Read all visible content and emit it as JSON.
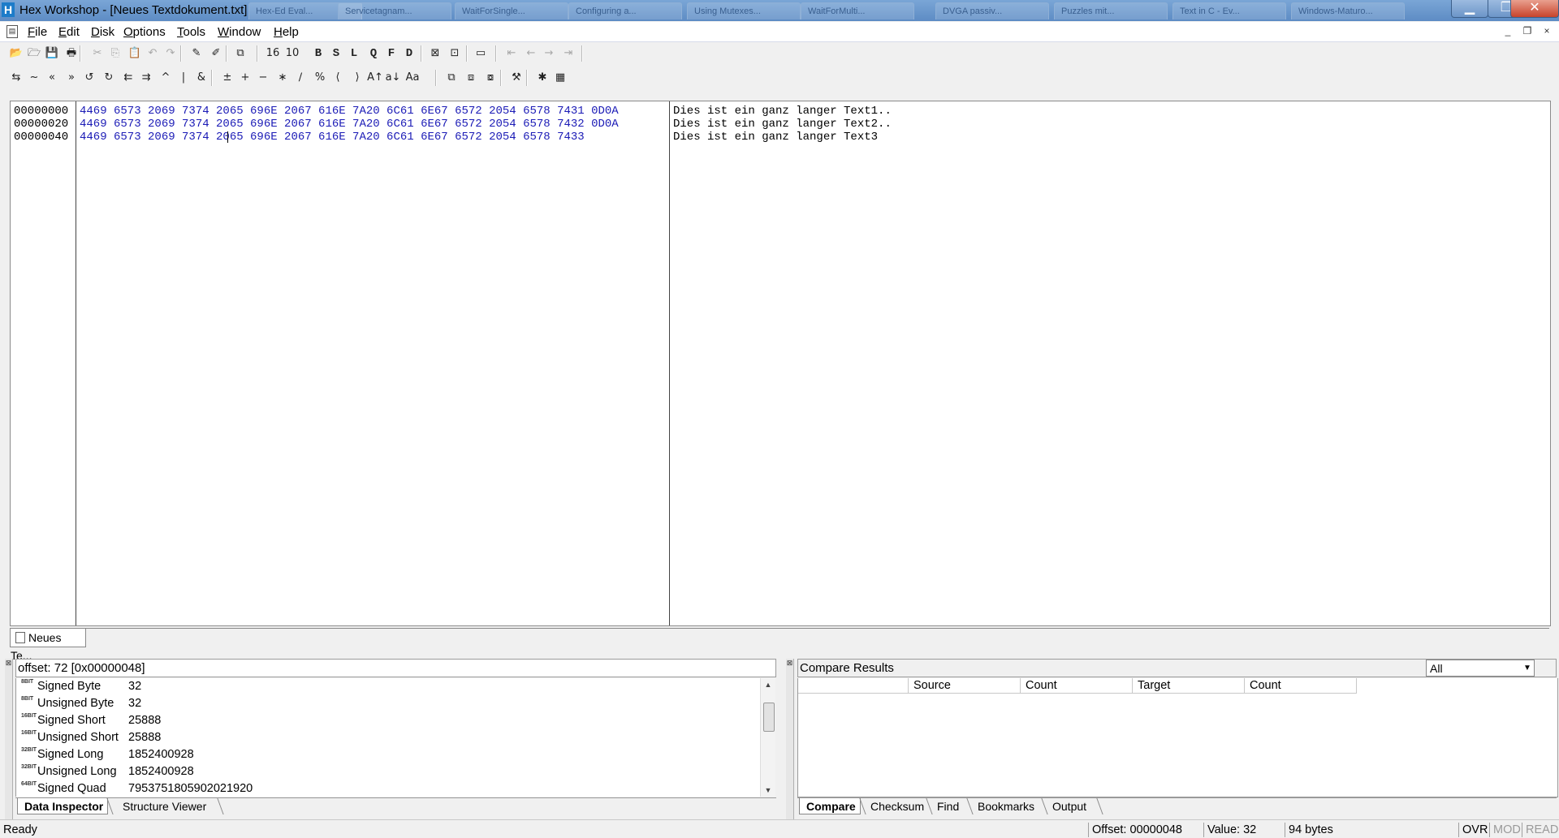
{
  "window": {
    "title": "Hex Workshop - [Neues Textdokument.txt]",
    "app_icon_letter": "H",
    "background_tabs": [
      "Hex-Ed Eval...",
      "Servicetagnam...",
      "WaitForSingle...",
      "Configuring a...",
      "Using Mutexes...",
      "WaitForMulti...",
      "DVGA passiv...",
      "Puzzles mit...",
      "Text in C - Ev...",
      "Windows-Maturo..."
    ],
    "caption_buttons": {
      "minimize": "▁",
      "maximize": "❐",
      "close": "✕"
    }
  },
  "menu": {
    "items": [
      {
        "label": "File",
        "accel": "F"
      },
      {
        "label": "Edit",
        "accel": "E"
      },
      {
        "label": "Disk",
        "accel": "D"
      },
      {
        "label": "Options",
        "accel": "O"
      },
      {
        "label": "Tools",
        "accel": "T"
      },
      {
        "label": "Window",
        "accel": "W"
      },
      {
        "label": "Help",
        "accel": "H"
      }
    ],
    "mdi_buttons": {
      "minimize": "_",
      "restore": "❐",
      "close": "×"
    }
  },
  "toolbar1": {
    "buttons": [
      {
        "name": "open-icon",
        "glyph": "📂"
      },
      {
        "name": "open-folder-icon",
        "glyph": "🗁"
      },
      {
        "name": "save-icon",
        "glyph": "💾"
      },
      {
        "name": "print-icon",
        "glyph": "🖶"
      },
      {
        "name": "cut-icon",
        "glyph": "✂"
      },
      {
        "name": "copy-icon",
        "glyph": "⎘"
      },
      {
        "name": "paste-icon",
        "glyph": "📋"
      },
      {
        "name": "undo-icon",
        "glyph": "↶"
      },
      {
        "name": "redo-icon",
        "glyph": "↷"
      },
      {
        "name": "find-icon",
        "glyph": "✎"
      },
      {
        "name": "replace-icon",
        "glyph": "✐"
      },
      {
        "name": "goto-icon",
        "glyph": "⧉"
      },
      {
        "name": "base-hex-icon",
        "glyph": "16"
      },
      {
        "name": "base-dec-icon",
        "glyph": "10"
      },
      {
        "name": "byte-icon",
        "glyph": "B"
      },
      {
        "name": "short-icon",
        "glyph": "S"
      },
      {
        "name": "long-icon",
        "glyph": "L"
      },
      {
        "name": "quad-icon",
        "glyph": "Q"
      },
      {
        "name": "float-icon",
        "glyph": "F"
      },
      {
        "name": "double-icon",
        "glyph": "D"
      },
      {
        "name": "edit-mode-icon",
        "glyph": "⊠"
      },
      {
        "name": "insert-mode-icon",
        "glyph": "⊡"
      },
      {
        "name": "window-icon",
        "glyph": "▭"
      },
      {
        "name": "first-icon",
        "glyph": "⇤"
      },
      {
        "name": "prev-icon",
        "glyph": "←"
      },
      {
        "name": "next-icon",
        "glyph": "→"
      },
      {
        "name": "last-icon",
        "glyph": "⇥"
      }
    ]
  },
  "toolbar2": {
    "buttons": [
      {
        "name": "swap-icon",
        "glyph": "⇆"
      },
      {
        "name": "not-icon",
        "glyph": "~"
      },
      {
        "name": "shift-left-icon",
        "glyph": "«"
      },
      {
        "name": "shift-right-icon",
        "glyph": "»"
      },
      {
        "name": "rotate-left-icon",
        "glyph": "↺"
      },
      {
        "name": "rotate-right-icon",
        "glyph": "↻"
      },
      {
        "name": "block-shift-left-icon",
        "glyph": "⇇"
      },
      {
        "name": "block-shift-right-icon",
        "glyph": "⇉"
      },
      {
        "name": "xor-icon",
        "glyph": "^"
      },
      {
        "name": "or-icon",
        "glyph": "|"
      },
      {
        "name": "and-icon",
        "glyph": "&"
      },
      {
        "name": "negate-icon",
        "glyph": "±"
      },
      {
        "name": "add-icon",
        "glyph": "+"
      },
      {
        "name": "subtract-icon",
        "glyph": "−"
      },
      {
        "name": "multiply-icon",
        "glyph": "∗"
      },
      {
        "name": "divide-icon",
        "glyph": "∕"
      },
      {
        "name": "modulo-icon",
        "glyph": "%"
      },
      {
        "name": "lower-bound-icon",
        "glyph": "⟨"
      },
      {
        "name": "upper-bound-icon",
        "glyph": "⟩"
      },
      {
        "name": "uppercase-icon",
        "glyph": "A↑"
      },
      {
        "name": "lowercase-icon",
        "glyph": "a↓"
      },
      {
        "name": "invert-case-icon",
        "glyph": "Aa"
      },
      {
        "name": "compare-icon",
        "glyph": "⧉"
      },
      {
        "name": "compare-next-icon",
        "glyph": "⧈"
      },
      {
        "name": "compare-prev-icon",
        "glyph": "⧇"
      },
      {
        "name": "tools-icon",
        "glyph": "⚒"
      },
      {
        "name": "chip-icon",
        "glyph": "✱"
      },
      {
        "name": "calculator-icon",
        "glyph": "▦"
      }
    ]
  },
  "editor": {
    "offsets": [
      "00000000",
      "00000020",
      "00000040"
    ],
    "hex_lines": [
      "4469 6573 2069 7374 2065 696E 2067 616E 7A20 6C61 6E67 6572 2054 6578 7431 0D0A",
      "4469 6573 2069 7374 2065 696E 2067 616E 7A20 6C61 6E67 6572 2054 6578 7432 0D0A",
      "4469 6573 2069 7374 2065 696E 2067 616E 7A20 6C61 6E67 6572 2054 6578 7433"
    ],
    "ascii_lines": [
      "Dies ist ein ganz langer Text1..",
      "Dies ist ein ganz langer Text2..",
      "Dies ist ein ganz langer Text3"
    ],
    "doc_tab": "Neues Te..."
  },
  "inspector": {
    "header": "offset: 72 [0x00000048]",
    "rows": [
      {
        "badge": "8BIT",
        "name": "Signed Byte",
        "value": "32"
      },
      {
        "badge": "8BIT",
        "name": "Unsigned Byte",
        "value": "32"
      },
      {
        "badge": "16BIT",
        "name": "Signed Short",
        "value": "25888"
      },
      {
        "badge": "16BIT",
        "name": "Unsigned Short",
        "value": "25888"
      },
      {
        "badge": "32BIT",
        "name": "Signed Long",
        "value": "1852400928"
      },
      {
        "badge": "32BIT",
        "name": "Unsigned Long",
        "value": "1852400928"
      },
      {
        "badge": "64BIT",
        "name": "Signed Quad",
        "value": "7953751805902021920"
      }
    ],
    "tabs": [
      "Data Inspector",
      "Structure Viewer"
    ]
  },
  "compare": {
    "header": "Compare Results",
    "filter_value": "All",
    "columns": [
      "",
      "Source",
      "Count",
      "Target",
      "Count"
    ],
    "tabs": [
      "Compare",
      "Checksum",
      "Find",
      "Bookmarks",
      "Output"
    ]
  },
  "status": {
    "ready": "Ready",
    "offset": "Offset: 00000048",
    "value": "Value: 32",
    "size": "94 bytes",
    "ovr": "OVR",
    "mod": "MOD",
    "read": "READ"
  }
}
